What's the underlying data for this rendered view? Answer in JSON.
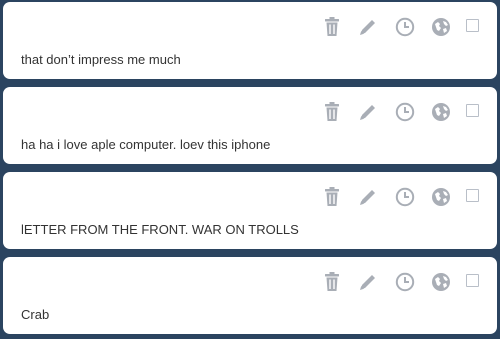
{
  "colors": {
    "background": "#2b4460",
    "card": "#ffffff",
    "icon": "#a9aeb6",
    "text": "#333333"
  },
  "actions": [
    "trash-icon",
    "pencil-icon",
    "clock-icon",
    "globe-icon",
    "checkbox"
  ],
  "posts": [
    {
      "text": "that don’t impress me much",
      "checked": false
    },
    {
      "text": "ha ha i love aple computer. loev this iphone",
      "checked": false
    },
    {
      "text": "lETTER FROM THE FRONT. WAR ON TROLLS",
      "checked": false
    },
    {
      "text": "Crab",
      "checked": false
    }
  ]
}
